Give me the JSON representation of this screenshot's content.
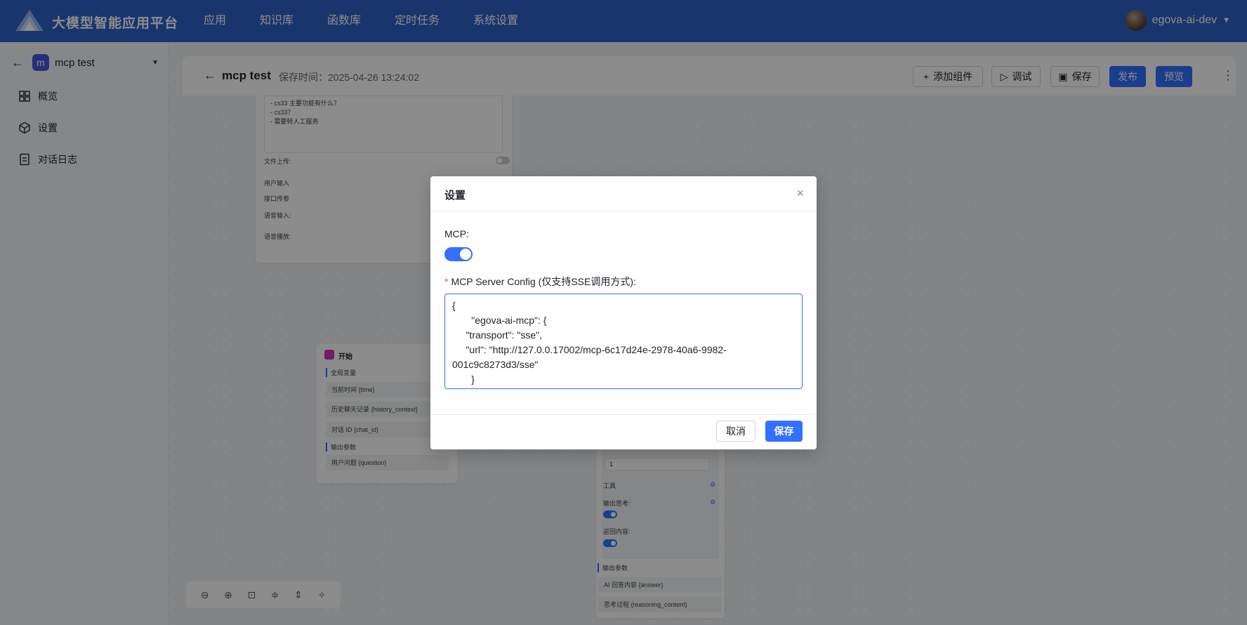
{
  "topbar": {
    "brand": "大模型智能应用平台",
    "nav": [
      "应用",
      "知识库",
      "函数库",
      "定时任务",
      "系统设置"
    ],
    "username": "egova-ai-dev"
  },
  "sidebar": {
    "app_badge": "m",
    "app_name": "mcp test",
    "items": [
      {
        "label": "概览",
        "icon": "grid-icon"
      },
      {
        "label": "设置",
        "icon": "cube-icon"
      },
      {
        "label": "对话日志",
        "icon": "document-icon"
      }
    ]
  },
  "editor": {
    "title": "mcp test",
    "save_time_label": "保存时间：",
    "save_time": "2025-04-26 13:24:02",
    "buttons": {
      "add_component": "添加组件",
      "debug": "调试",
      "save": "保存",
      "publish": "发布",
      "preview": "预览"
    }
  },
  "base_node": {
    "prologue_lines": [
      "- cs33 主要功能有什么？",
      "- cs33？",
      "- 需要转人工服务"
    ],
    "file_upload": "文件上传:",
    "user_input": "用户输入",
    "api_params": "接口传参",
    "voice_input": "语音输入:",
    "voice_play": "语音播放:"
  },
  "start_node": {
    "title": "开始",
    "global_vars_label": "全局变量",
    "global_vars": [
      "当前时间 {time}",
      "历史聊天记录 {history_context}",
      "对话 ID {chat_id}"
    ],
    "output_label": "输出参数",
    "outputs": [
      "用户问题 {question}"
    ]
  },
  "ai_node": {
    "number_value": "1",
    "tools": "工具",
    "output_thinking": "输出思考:",
    "return_content": "返回内容:",
    "output_label": "输出参数",
    "outputs": [
      "AI 回答内容 {answer}",
      "思考过程 {reasoning_content}"
    ]
  },
  "modal": {
    "title": "设置",
    "mcp_label": "MCP:",
    "mcp_enabled": true,
    "config_label": "MCP Server Config (仅支持SSE调用方式):",
    "config_value": "{\n       \"egova-ai-mcp\": {\n     \"transport\": \"sse\",\n     \"url\": \"http://127.0.0.17002/mcp-6c17d24e-2978-40a6-9982-001c9c8273d3/sse\"\n       }",
    "cancel": "取消",
    "save": "保存"
  },
  "colors": {
    "topbar": "#2f62c7",
    "primary": "#3370ff",
    "required": "#f54a45"
  }
}
